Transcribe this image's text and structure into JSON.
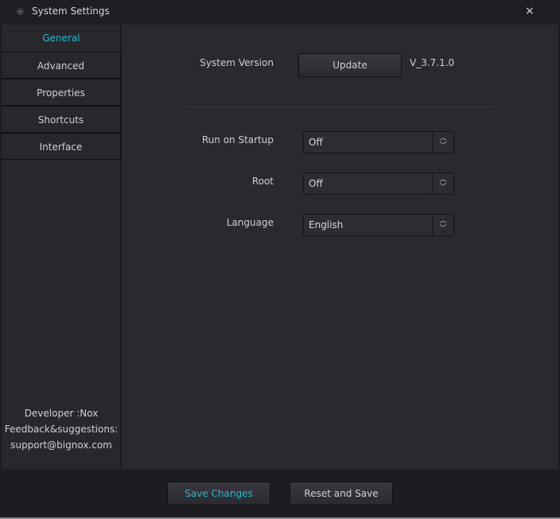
{
  "window": {
    "title": "System Settings",
    "icon": "gear-icon",
    "close_label": "×"
  },
  "sidebar": {
    "items": [
      {
        "label": "General",
        "active": true
      },
      {
        "label": "Advanced"
      },
      {
        "label": "Properties"
      },
      {
        "label": "Shortcuts"
      },
      {
        "label": "Interface"
      }
    ],
    "info": {
      "developer": "Developer :Nox",
      "feedback": "Feedback&suggestions:",
      "email": "support@bignox.com"
    }
  },
  "general": {
    "system_version_label": "System Version",
    "update_label": "Update",
    "version": "V_3.7.1.0",
    "run_on_startup_label": "Run on Startup",
    "run_on_startup_value": "Off",
    "root_label": "Root",
    "root_value": "Off",
    "language_label": "Language",
    "language_value": "English"
  },
  "footer": {
    "save_label": "Save Changes",
    "reset_label": "Reset and Save"
  },
  "colors": {
    "accent": "#2ab8d0",
    "background": "#29292e",
    "titlebar": "#1e1e22"
  }
}
